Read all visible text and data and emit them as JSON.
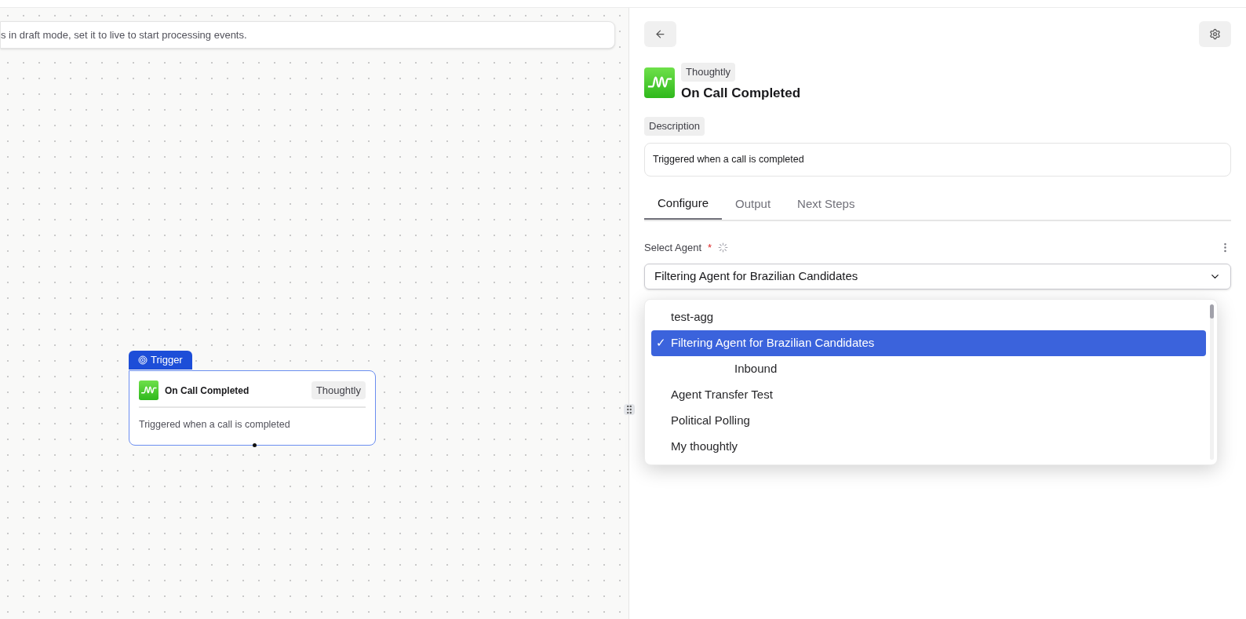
{
  "banner": {
    "text": "s in draft mode, set it to live to start processing events."
  },
  "node": {
    "tag": "Trigger",
    "title": "On Call Completed",
    "badge": "Thoughtly",
    "description": "Triggered when a call is completed"
  },
  "panel": {
    "app": "Thoughtly",
    "title": "On Call Completed",
    "description_label": "Description",
    "description": "Triggered when a call is completed",
    "tabs": [
      {
        "label": "Configure",
        "selected": true
      },
      {
        "label": "Output",
        "selected": false
      },
      {
        "label": "Next Steps",
        "selected": false
      }
    ],
    "field": {
      "label": "Select Agent",
      "required": "*",
      "loading": true,
      "value": "Filtering Agent for Brazilian Candidates"
    },
    "options": [
      {
        "label": "test-agg",
        "kind": "option",
        "selected": false
      },
      {
        "label": "Filtering Agent for Brazilian Candidates",
        "kind": "option",
        "selected": true,
        "check": "✓"
      },
      {
        "label": "Inbound",
        "kind": "sub",
        "selected": false
      },
      {
        "label": "Agent Transfer Test",
        "kind": "option",
        "selected": false
      },
      {
        "label": "Political Polling",
        "kind": "option",
        "selected": false
      },
      {
        "label": "My thoughtly",
        "kind": "option",
        "selected": false
      }
    ]
  }
}
